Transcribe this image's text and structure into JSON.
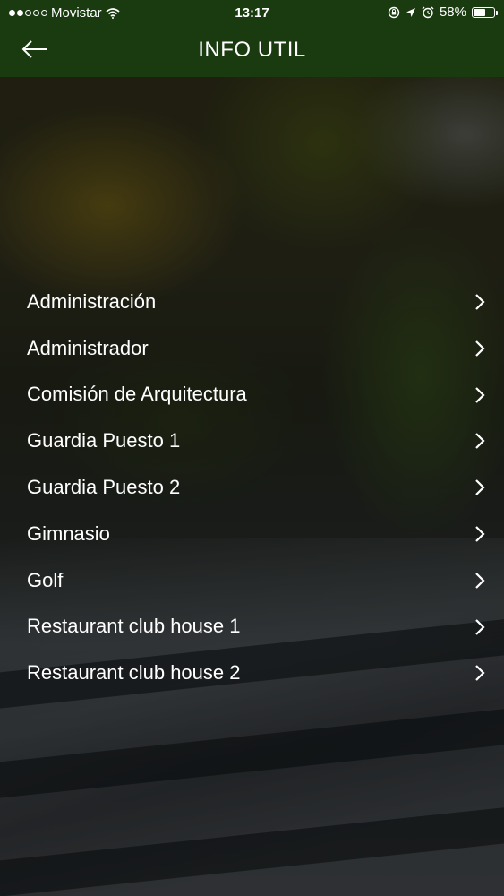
{
  "status_bar": {
    "carrier": "Movistar",
    "time": "13:17",
    "battery_percent": "58%",
    "battery_level": 0.58,
    "signal_bars_filled": 2,
    "signal_bars_total": 5
  },
  "header": {
    "title": "INFO UTIL",
    "back_icon": "arrow-left-icon",
    "background_color": "#1a3a10"
  },
  "menu": {
    "items": [
      {
        "label": "Administración"
      },
      {
        "label": "Administrador"
      },
      {
        "label": "Comisión de Arquitectura"
      },
      {
        "label": "Guardia Puesto 1"
      },
      {
        "label": "Guardia Puesto 2"
      },
      {
        "label": "Gimnasio"
      },
      {
        "label": "Golf"
      },
      {
        "label": "Restaurant club house 1"
      },
      {
        "label": "Restaurant club house 2"
      }
    ],
    "chevron_icon": "chevron-right-icon"
  }
}
